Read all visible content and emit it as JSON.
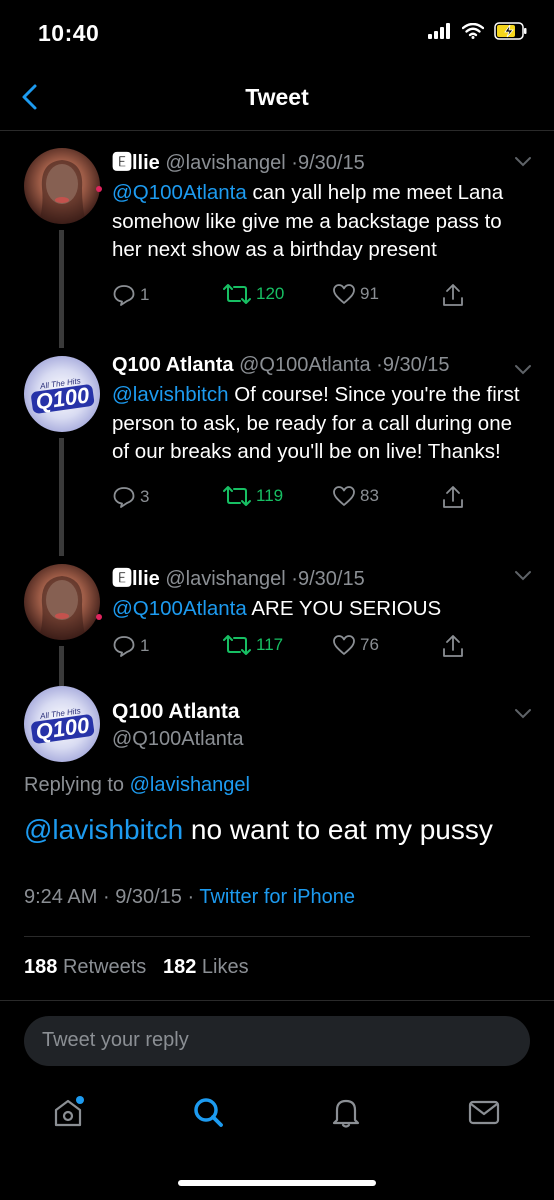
{
  "status": {
    "time": "10:40"
  },
  "nav": {
    "title": "Tweet"
  },
  "thread": [
    {
      "name": "🅴llie",
      "handle": "@lavishangel",
      "date": "9/30/15",
      "mention": "@Q100Atlanta",
      "text": " can yall help me meet Lana somehow like give me a backstage pass to her next show as a birthday present",
      "replies": "1",
      "retweets": "120",
      "likes": "91"
    },
    {
      "name": "Q100 Atlanta",
      "handle": "@Q100Atlanta",
      "date": "9/30/15",
      "mention": "@lavishbitch",
      "text": " Of course! Since you're the first person to ask, be ready for a call during one of our breaks and you'll be on live! Thanks!",
      "replies": "3",
      "retweets": "119",
      "likes": "83"
    },
    {
      "name": "🅴llie",
      "handle": "@lavishangel",
      "date": "9/30/15",
      "mention": "@Q100Atlanta",
      "text": " ARE YOU SERIOUS",
      "replies": "1",
      "retweets": "117",
      "likes": "76"
    }
  ],
  "main": {
    "name": "Q100 Atlanta",
    "handle": "@Q100Atlanta",
    "replying_prefix": "Replying to ",
    "replying_to": "@lavishangel",
    "mention": "@lavishbitch",
    "text": " no want to eat my pussy",
    "time": "9:24 AM",
    "date": "9/30/15",
    "source": "Twitter for iPhone",
    "retweets_count": "188",
    "retweets_label": "Retweets",
    "likes_count": "182",
    "likes_label": "Likes"
  },
  "avatar_logo": {
    "top": "All The Hits",
    "name": "Q100"
  },
  "reply": {
    "placeholder": "Tweet your reply"
  },
  "tabs": [
    "home-icon",
    "search-icon",
    "notifications-icon",
    "messages-icon"
  ],
  "colors": {
    "accent": "#1d9bf0",
    "retweet": "#17bf63",
    "background": "#000000",
    "muted": "#8b8f94"
  }
}
